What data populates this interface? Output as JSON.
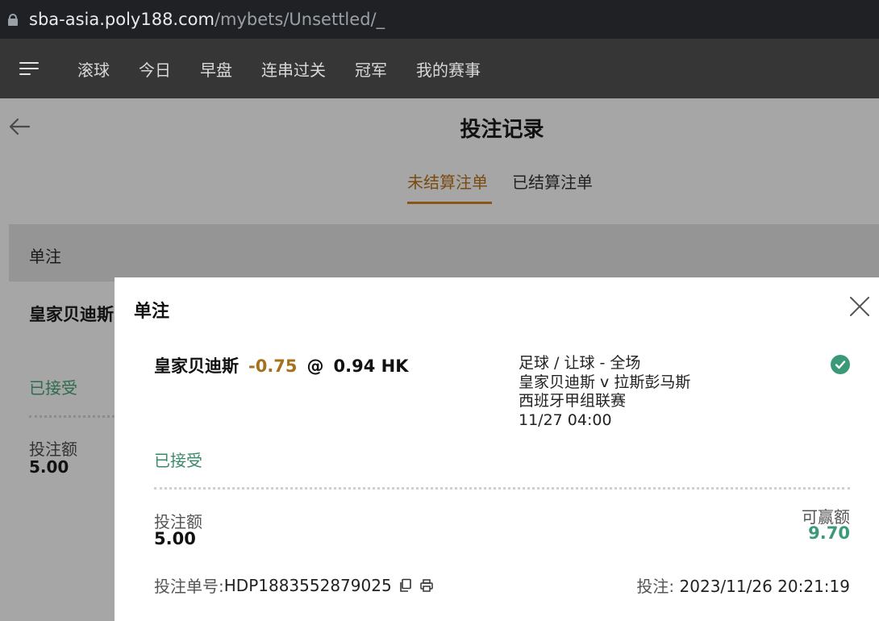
{
  "browser": {
    "url_host": "sba-asia.poly188.com",
    "url_path": "/mybets/Unsettled/_"
  },
  "nav": {
    "items": [
      "滚球",
      "今日",
      "早盘",
      "连串过关",
      "冠军",
      "我的赛事"
    ]
  },
  "page": {
    "title": "投注记录",
    "tabs": {
      "unsettled": "未结算注单",
      "settled": "已结算注单"
    }
  },
  "background_list": {
    "section_label": "单注",
    "team": "皇家贝迪斯",
    "status": "已接受",
    "stake_label": "投注额",
    "stake": "5.00"
  },
  "modal": {
    "title": "单注",
    "selection": "皇家贝迪斯",
    "handicap": "-0.75",
    "at": "@",
    "odds": "0.94 HK",
    "market": "足球 / 让球 - 全场",
    "match": "皇家贝迪斯 v 拉斯彭马斯",
    "league": "西班牙甲组联赛",
    "kickoff": "11/27 04:00",
    "status": "已接受",
    "stake_label": "投注额",
    "stake": "5.00",
    "to_win_label": "可赢额",
    "to_win": "9.70",
    "ref_label": "投注单号: ",
    "ref_no": "HDP1883552879025",
    "placed_label": "投注: ",
    "placed_time": "2023/11/26 20:21:19"
  },
  "colors": {
    "accent_tab": "#8a5616",
    "handicap": "#a5711c",
    "success": "#3a9a78"
  }
}
